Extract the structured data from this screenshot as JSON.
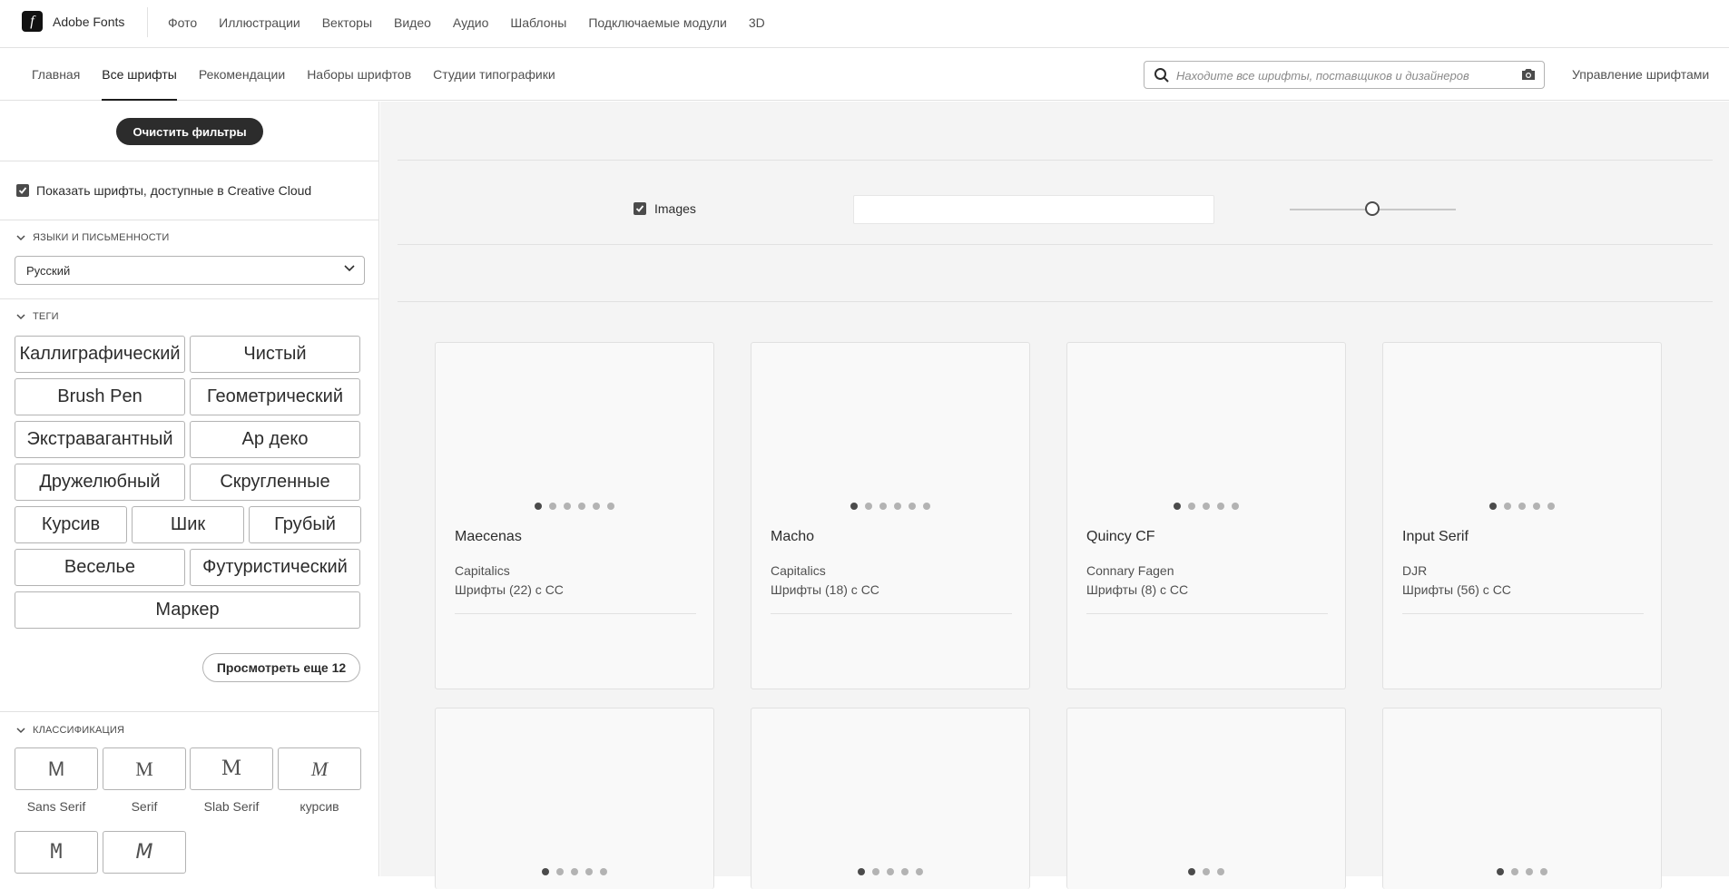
{
  "app": {
    "logo_glyph": "f",
    "title": "Adobe Fonts"
  },
  "topnav": [
    "Фото",
    "Иллюстрации",
    "Векторы",
    "Видео",
    "Аудио",
    "Шаблоны",
    "Подключаемые модули",
    "3D"
  ],
  "subnav": {
    "tabs": [
      "Главная",
      "Все шрифты",
      "Рекомендации",
      "Наборы шрифтов",
      "Студии типографики"
    ],
    "active_index": 1,
    "search_placeholder": "Находите все шрифты, поставщиков и дизайнеров",
    "manage_label": "Управление шрифтами"
  },
  "sidebar": {
    "clear_filters": "Очистить фильтры",
    "cc_checkbox_label": "Показать шрифты, доступные в Creative Cloud",
    "cc_checked": true,
    "languages_title": "ЯЗЫКИ И ПИСЬМЕННОСТИ",
    "language_selected": "Русский",
    "tags_title": "ТЕГИ",
    "tag_rows": [
      [
        "Каллиграфический",
        "Чистый"
      ],
      [
        "Brush Pen",
        "Геометрический"
      ],
      [
        "Экстравагантный",
        "Ар деко"
      ],
      [
        "Дружелюбный",
        "Скругленные"
      ],
      [
        "Курсив",
        "Шик",
        "Грубый"
      ],
      [
        "Веселье",
        "Футуристический"
      ],
      [
        "Маркер"
      ]
    ],
    "view_more": "Просмотреть еще 12",
    "classification_title": "КЛАССИФИКАЦИЯ",
    "classifications": [
      {
        "label": "Sans Serif",
        "glyph": "M"
      },
      {
        "label": "Serif",
        "glyph": "M"
      },
      {
        "label": "Slab Serif",
        "glyph": "M"
      },
      {
        "label": "курсив",
        "glyph": "M"
      },
      {
        "label": "",
        "glyph": "M"
      },
      {
        "label": "",
        "glyph": "M"
      }
    ]
  },
  "main": {
    "images_label": "Images",
    "images_checked": true,
    "sample_text_value": "",
    "size_slider_value": 0.5
  },
  "cards": [
    {
      "name": "Maecenas",
      "foundry": "Capitalics",
      "count": "Шрифты (22) с CC",
      "dots": 6,
      "active_dot": 0
    },
    {
      "name": "Macho",
      "foundry": "Capitalics",
      "count": "Шрифты (18) с CC",
      "dots": 6,
      "active_dot": 0
    },
    {
      "name": "Quincy CF",
      "foundry": "Connary Fagen",
      "count": "Шрифты (8) с CC",
      "dots": 5,
      "active_dot": 0
    },
    {
      "name": "Input Serif",
      "foundry": "DJR",
      "count": "Шрифты (56) с CC",
      "dots": 5,
      "active_dot": 0
    },
    {
      "name": "",
      "foundry": "",
      "count": "",
      "dots": 5,
      "active_dot": 0
    },
    {
      "name": "",
      "foundry": "",
      "count": "",
      "dots": 5,
      "active_dot": 0
    },
    {
      "name": "",
      "foundry": "",
      "count": "",
      "dots": 3,
      "active_dot": 0
    },
    {
      "name": "",
      "foundry": "",
      "count": "",
      "dots": 4,
      "active_dot": 0
    }
  ]
}
